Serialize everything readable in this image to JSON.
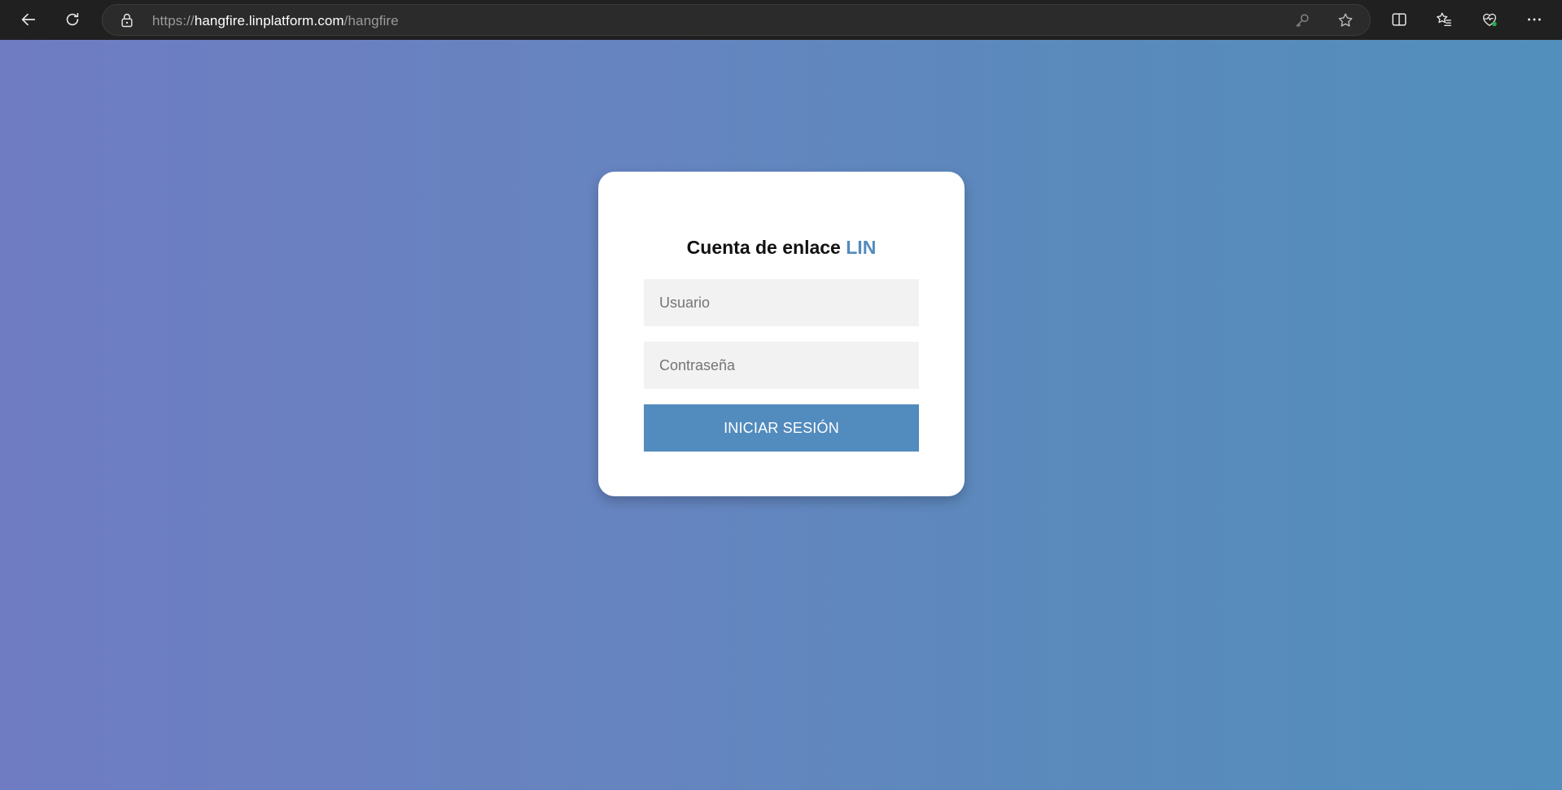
{
  "browser": {
    "url_scheme": "https://",
    "url_host": "hangfire.linplatform.com",
    "url_path": "/hangfire",
    "icons": {
      "back": "back-arrow-icon",
      "refresh": "refresh-icon",
      "lock": "lock-icon",
      "key": "key-icon",
      "favorite": "star-icon",
      "split_screen": "split-screen-icon",
      "favorites": "favorites-icon",
      "browser_essentials": "heart-pulse-icon",
      "more": "more-dots-icon"
    }
  },
  "login": {
    "title": "Cuenta de enlace ",
    "brand": "LIN",
    "username_placeholder": "Usuario",
    "password_placeholder": "Contraseña",
    "submit_label": "INICIAR SESIÓN"
  },
  "colors": {
    "accent": "#528bbd",
    "background_start": "#6f7cc2",
    "background_end": "#528fbc",
    "card": "#ffffff",
    "input_bg": "#f2f2f2"
  }
}
